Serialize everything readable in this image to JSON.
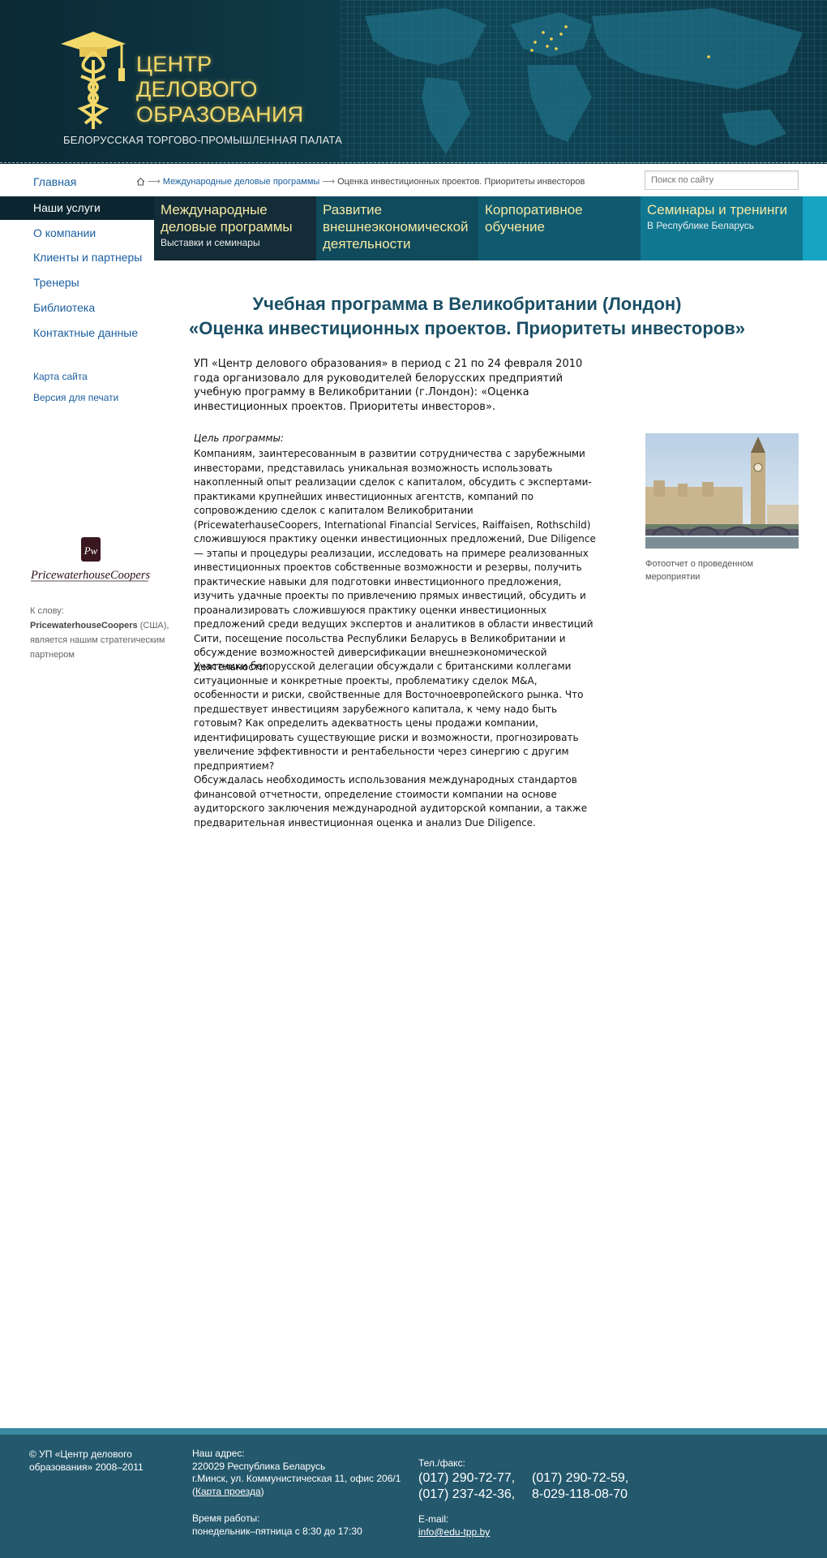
{
  "header": {
    "logo_lines": [
      "ЦЕНТР",
      "ДЕЛОВОГО",
      "ОБРАЗОВАНИЯ"
    ],
    "logo_subtitle": "БЕЛОРУССКАЯ ТОРГОВО-ПРОМЫШЛЕННАЯ ПАЛАТА"
  },
  "nav": {
    "home": "Главная",
    "items": [
      {
        "label": "Наши услуги",
        "active": true
      },
      {
        "label": "О компании"
      },
      {
        "label": "Клиенты и партнеры"
      },
      {
        "label": "Тренеры"
      },
      {
        "label": "Библиотека"
      },
      {
        "label": "Контактные данные"
      }
    ],
    "secondary": [
      "Карта сайта",
      "Версия для печати"
    ]
  },
  "breadcrumb": {
    "link": "Международные деловые программы",
    "current": "Оценка инвестиционных проектов. Приоритеты инвесторов"
  },
  "search": {
    "placeholder": "Поиск по сайту"
  },
  "tiles": [
    {
      "title": "Международные деловые программы",
      "subtitle": "Выставки и семинары"
    },
    {
      "title": "Развитие внешнеэкономической деятельности",
      "subtitle": ""
    },
    {
      "title": "Корпоративное обучение",
      "subtitle": ""
    },
    {
      "title": "Семинары и тренинги",
      "subtitle": "В Республике Беларусь"
    }
  ],
  "sidebar": {
    "partner_logo_text": "PricewaterhouseCoopers",
    "note_prefix": "К слову:",
    "note_bold": "PricewaterhouseCoopers",
    "note_rest": " (США), является нашим стратегическим партнером"
  },
  "main": {
    "title_line1": "Учебная программа в Великобритании (Лондон)",
    "title_line2": "«Оценка инвестиционных проектов. Приоритеты инвесторов»",
    "intro": "УП «Центр делового образования» в период с 21 по 24 февраля 2010 года организовало для руководителей белорусских предприятий учебную программу в Великобритании (г.Лондон): «Оценка инвестиционных проектов. Приоритеты инвесторов».",
    "goal_label": "Цель программы:",
    "p1": "Компаниям, заинтересованным в развитии сотрудничества с зарубежными инвесторами, представилась уникальная возможность использовать  накопленный опыт реализации сделок с капиталом, обсудить  с экспертами-практиками крупнейших инвестиционных агентств,  компаний по сопровождению сделок с капиталом Великобритании (PricewaterhauseCoopers, International Financial Services, Raiffaisen, Rothschild) сложившуюся практику оценки инвестиционных предложений, Due Diligence — этапы и процедуры реализации, исследовать на примере реализованных инвестиционных проектов собственные возможности и резервы, получить практические навыки для подготовки инвестиционного предложения, изучить удачные  проекты по привлечению прямых инвестиций, обсудить и проанализировать сложившуюся практику оценки инвестиционных предложений среди ведущих экспертов и аналитиков в области инвестиций Сити, посещение посольства Республики Беларусь в Великобритании и обсуждение возможностей диверсификации внешнеэкономической деятельности.",
    "p2": "Участники белорусской делегации обсуждали с британскими коллегами ситуационные и конкретные проекты, проблематику сделок M&A, особенности и риски, свойственные для Восточноевропейского рынка. Что предшествует инвестициям зарубежного капитала, к чему надо быть готовым? Как определить адекватность цены продажи компании, идентифицировать существующие риски и возможности, прогнозировать увеличение эффективности и рентабельности через синергию с другим предприятием?",
    "p3": "Обсуждалась необходимость использования международных стандартов финансовой отчетности, определение стоимости компании на основе аудиторского заключения международной аудиторской компании, а также предварительная инвестиционная оценка и анализ Due Diligence.",
    "photo_caption": "Фотоотчет о проведенном мероприятии"
  },
  "footer": {
    "copyright": "© УП «Центр делового образования» 2008–2011",
    "address_label": "Наш адрес:",
    "address_line1": "220029 Республика Беларусь",
    "address_line2": "г.Минск, ул. Коммунистическая 11, офис 206/1",
    "map_link": "Карта проезда",
    "hours_label": "Время работы:",
    "hours": "понедельник–пятница с 8:30 до 17:30",
    "tel_label": "Тел./факс:",
    "phones": [
      "(017) 290-72-77,",
      "(017) 290-72-59,",
      "(017) 237-42-36,",
      "8-029-118-08-70"
    ],
    "email_label": "E-mail:",
    "email": "info@edu-tpp.by"
  }
}
